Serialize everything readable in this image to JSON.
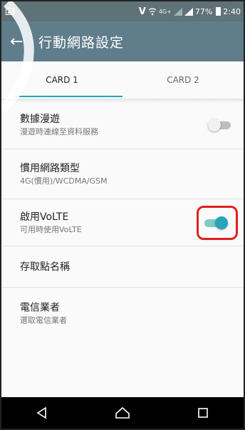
{
  "status_bar": {
    "volte": "V",
    "network_small": "4G+",
    "battery": "77%",
    "time": "2:40"
  },
  "app_bar": {
    "title": "行動網路設定"
  },
  "tabs": [
    {
      "label": "CARD 1",
      "active": true
    },
    {
      "label": "CARD 2",
      "active": false
    }
  ],
  "settings": [
    {
      "label": "數據漫遊",
      "summary": "漫遊時連線至資料服務",
      "switch": "off"
    },
    {
      "label": "慣用網路類型",
      "summary": "4G(慣用)/WCDMA/GSM"
    },
    {
      "label": "啟用VoLTE",
      "summary": "可用時使用VoLTE",
      "switch": "on"
    },
    {
      "label": "存取點名稱"
    },
    {
      "label": "電信業者",
      "summary": "選取電信業者"
    }
  ],
  "colors": {
    "accent": "#26a6b8",
    "app_bar": "#607d8b",
    "status_bar": "#5f7278",
    "highlight": "#e02020"
  }
}
